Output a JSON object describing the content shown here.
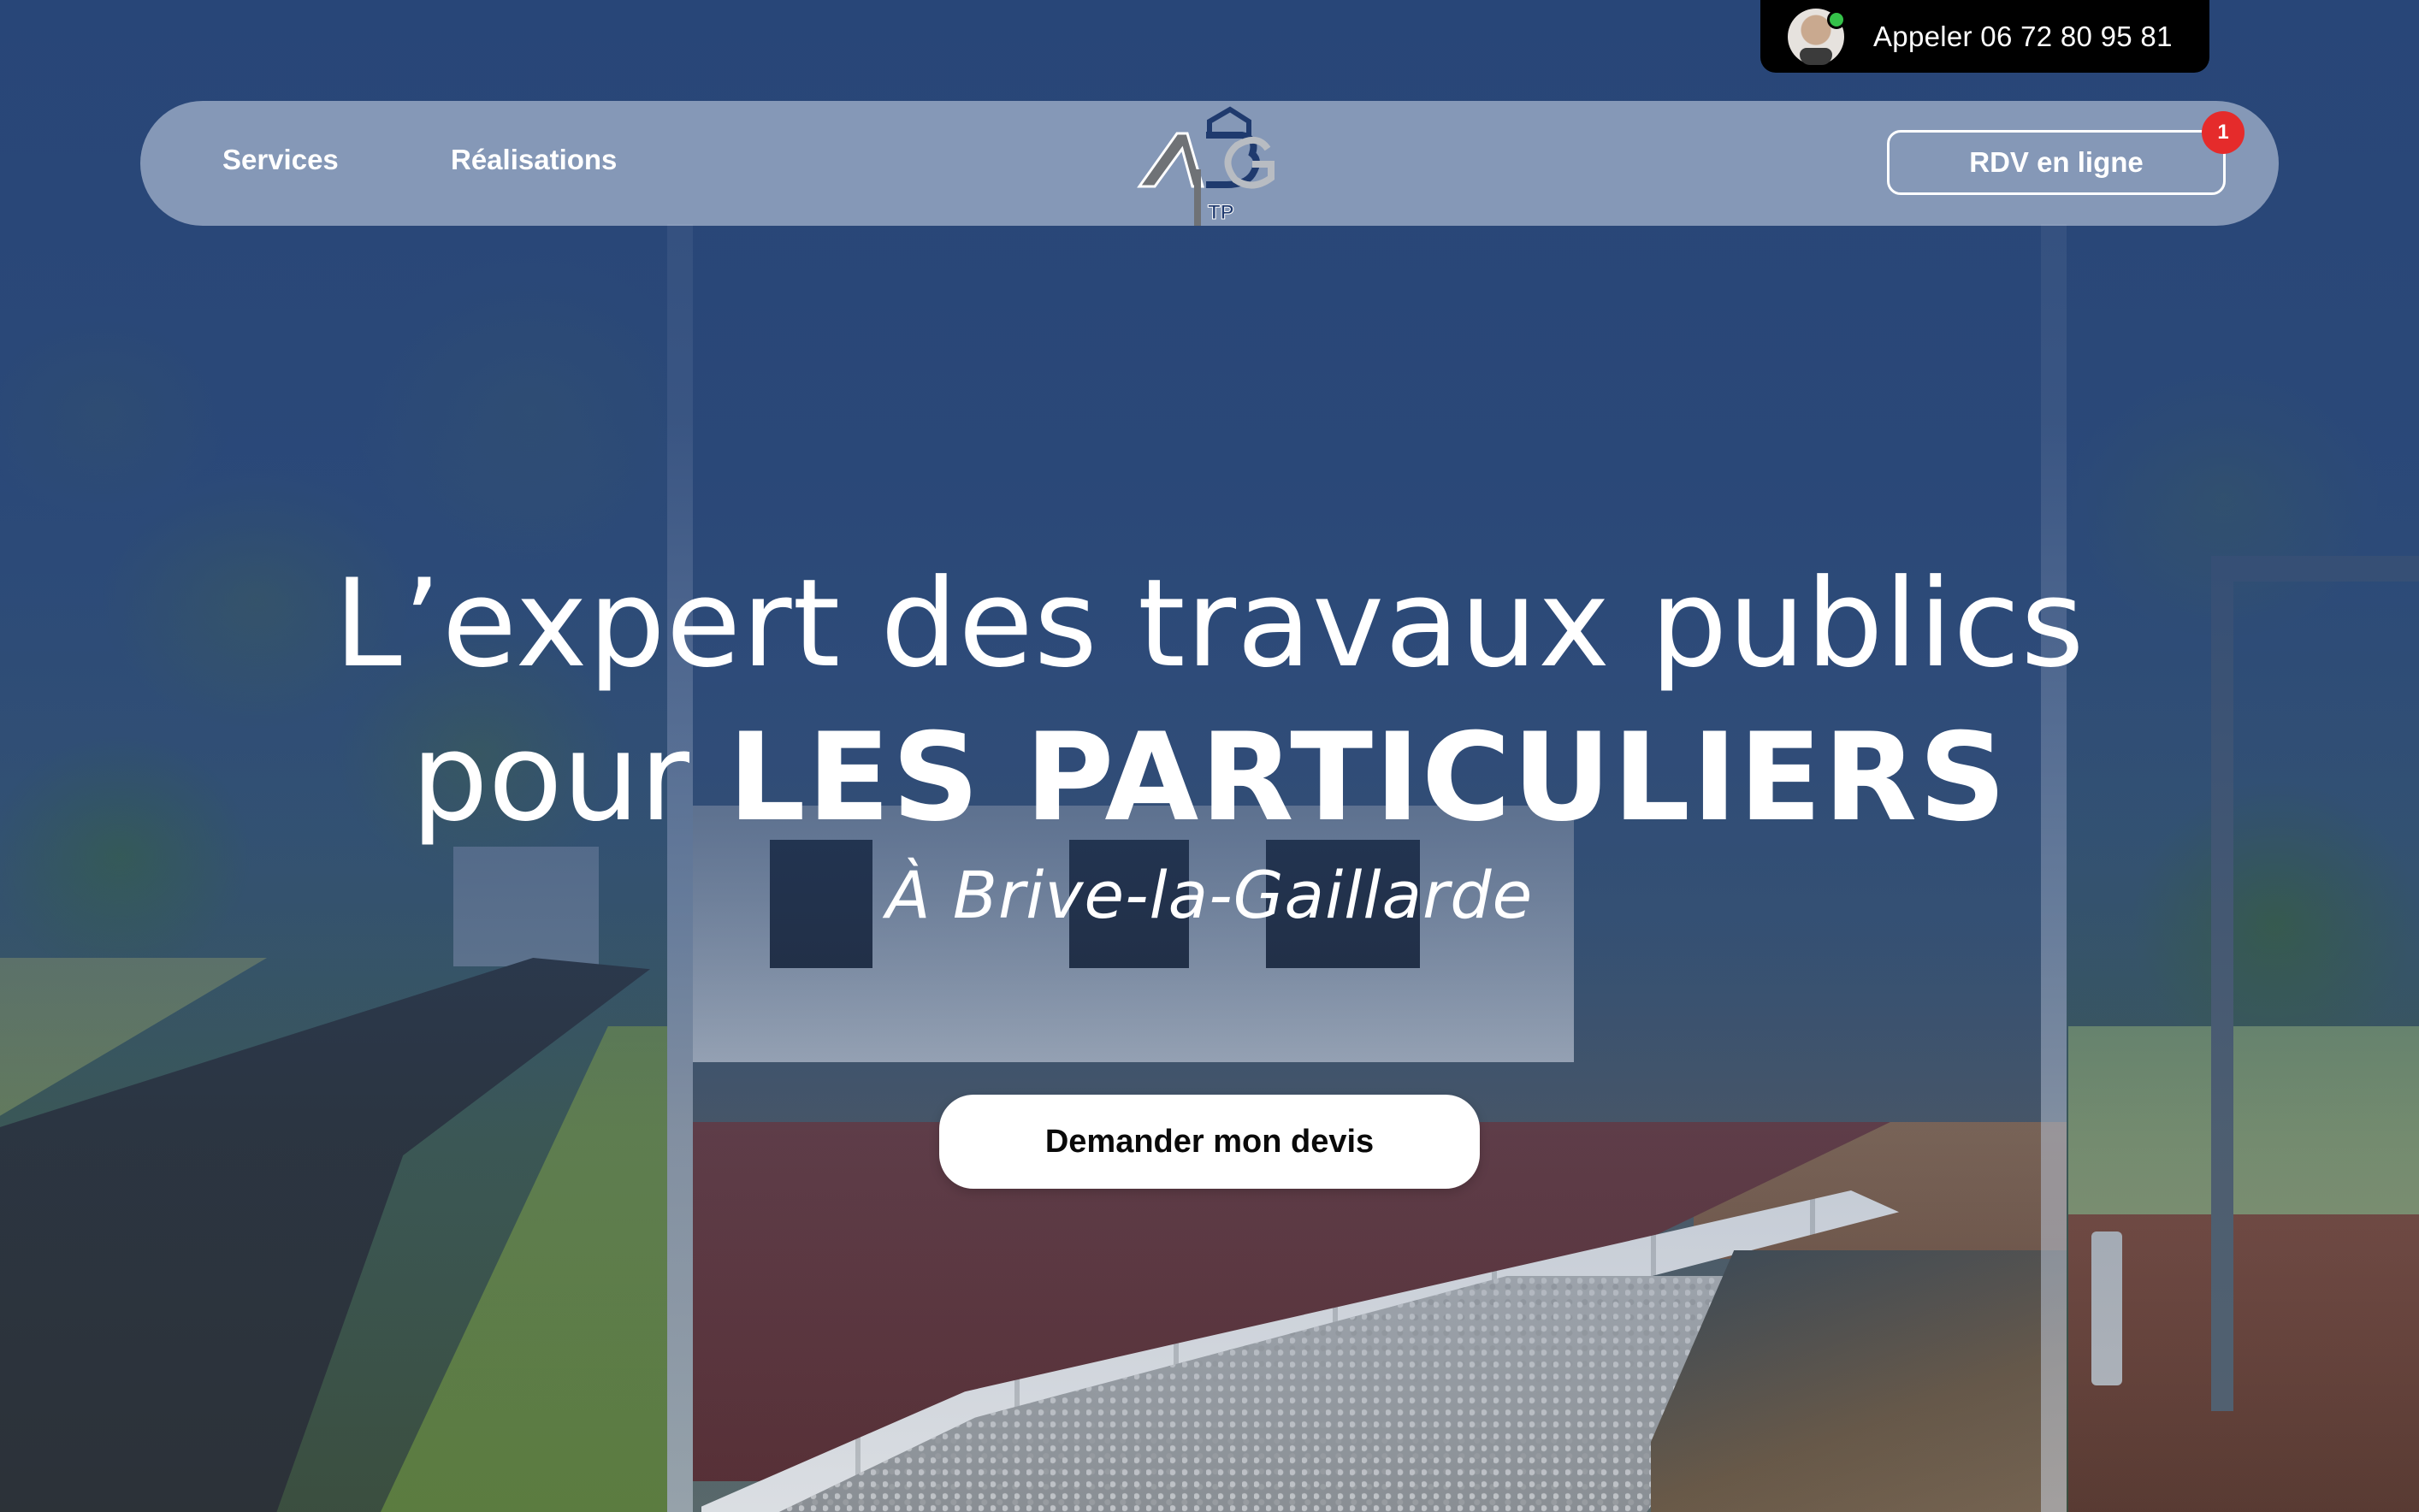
{
  "header": {
    "call_label": "Appeler 06 72 80 95 81",
    "online_status_color": "#35c24a"
  },
  "nav": {
    "links": [
      {
        "label": "Services"
      },
      {
        "label": "Réalisations"
      }
    ],
    "logo": {
      "letters": "ABG",
      "suffix": "TP",
      "icon": "company-logo"
    },
    "rdv_label": "RDV en ligne",
    "rdv_badge": "1",
    "badge_color": "#e52b2b"
  },
  "hero": {
    "line1": "L’expert des travaux publics",
    "line2_prefix": "pour ",
    "line2_strong": "LES PARTICULIERS",
    "subtitle": "À Brive-la-Gaillarde",
    "cta_label": "Demander mon devis"
  },
  "colors": {
    "tint": "#284678",
    "nav_bg": "#becade",
    "cta_bg": "#ffffff"
  }
}
